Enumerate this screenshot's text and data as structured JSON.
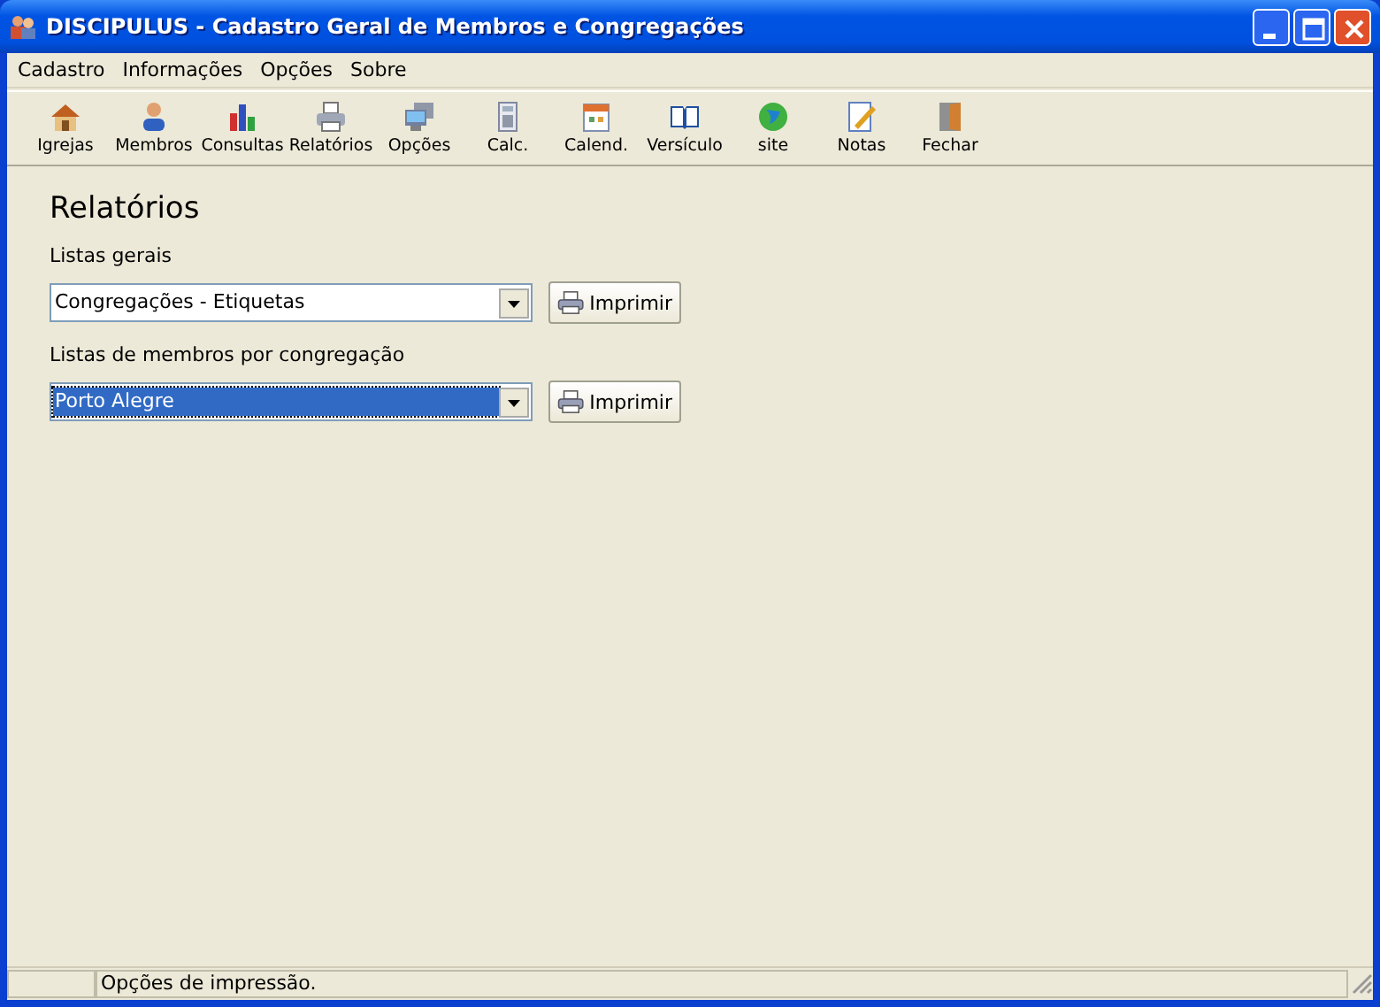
{
  "window": {
    "title": "DISCIPULUS - Cadastro Geral de Membros e Congregações"
  },
  "menu": [
    {
      "label": "Cadastro"
    },
    {
      "label": "Informações"
    },
    {
      "label": "Opções"
    },
    {
      "label": "Sobre"
    }
  ],
  "toolbar": [
    {
      "label": "Igrejas",
      "kind": "house"
    },
    {
      "label": "Membros",
      "kind": "person"
    },
    {
      "label": "Consultas",
      "kind": "chart"
    },
    {
      "label": "Relatórios",
      "kind": "printer"
    },
    {
      "label": "Opções",
      "kind": "monitor"
    },
    {
      "label": "Calc.",
      "kind": "calculator"
    },
    {
      "label": "Calend.",
      "kind": "calendar"
    },
    {
      "label": "Versículo",
      "kind": "book"
    },
    {
      "label": "site",
      "kind": "globe"
    },
    {
      "label": "Notas",
      "kind": "note"
    },
    {
      "label": "Fechar",
      "kind": "door"
    }
  ],
  "page": {
    "heading": "Relatórios",
    "sections": [
      {
        "label": "Listas gerais",
        "value": "Congregações - Etiquetas",
        "focused": false,
        "button": "Imprimir"
      },
      {
        "label": "Listas de membros por congregação",
        "value": "Porto Alegre",
        "focused": true,
        "button": "Imprimir"
      }
    ]
  },
  "status_bar": {
    "message": "Opções de impressão."
  }
}
